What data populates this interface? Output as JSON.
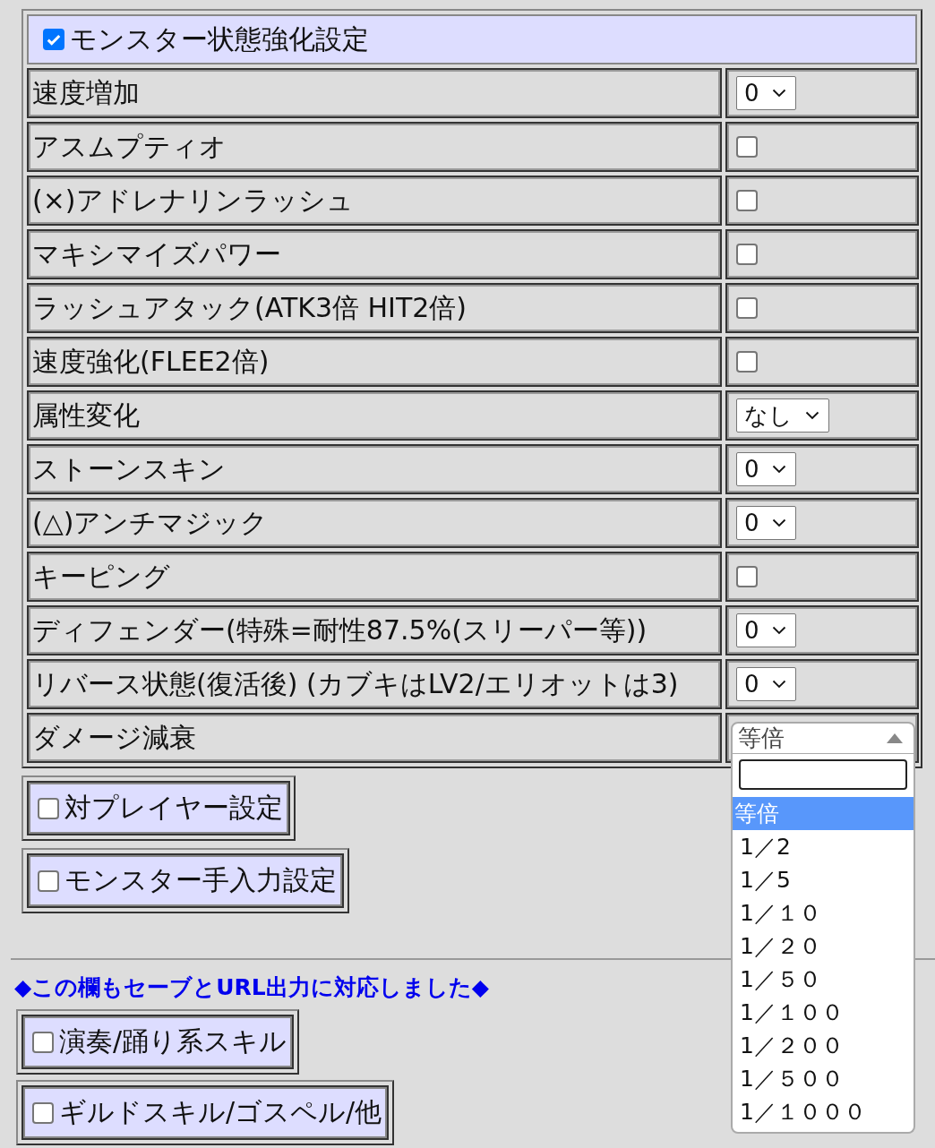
{
  "header": {
    "label": "モンスター状態強化設定",
    "checked": true
  },
  "rows": [
    {
      "label": "速度増加",
      "kind": "select",
      "value": "0"
    },
    {
      "label": "アスムプティオ",
      "kind": "checkbox",
      "checked": false
    },
    {
      "label": "(×)アドレナリンラッシュ",
      "kind": "checkbox",
      "checked": false
    },
    {
      "label": "マキシマイズパワー",
      "kind": "checkbox",
      "checked": false
    },
    {
      "label": "ラッシュアタック(ATK3倍 HIT2倍)",
      "kind": "checkbox",
      "checked": false
    },
    {
      "label": "速度強化(FLEE2倍)",
      "kind": "checkbox",
      "checked": false
    },
    {
      "label": "属性変化",
      "kind": "select",
      "value": "なし"
    },
    {
      "label": "ストーンスキン",
      "kind": "select",
      "value": "0"
    },
    {
      "label": "(△)アンチマジック",
      "kind": "select",
      "value": "0"
    },
    {
      "label": "キーピング",
      "kind": "checkbox",
      "checked": false
    },
    {
      "label": "ディフェンダー(特殊=耐性87.5%(スリーパー等))",
      "kind": "select",
      "value": "0"
    },
    {
      "label": "リバース状態(復活後) (カブキはLV2/エリオットは3)",
      "kind": "select",
      "value": "0"
    },
    {
      "label": "ダメージ減衰",
      "kind": "open_select",
      "value": "等倍",
      "options": [
        {
          "label": "等倍",
          "selected": true
        },
        {
          "label": "1／2",
          "selected": false
        },
        {
          "label": "1／5",
          "selected": false
        },
        {
          "label": "1／１０",
          "selected": false
        },
        {
          "label": "1／２０",
          "selected": false
        },
        {
          "label": "1／５０",
          "selected": false
        },
        {
          "label": "1／１００",
          "selected": false
        },
        {
          "label": "1／２００",
          "selected": false
        },
        {
          "label": "1／５００",
          "selected": false
        },
        {
          "label": "1／１０００",
          "selected": false
        }
      ]
    }
  ],
  "sections": [
    {
      "label": "対プレイヤー設定",
      "checked": false
    },
    {
      "label": "モンスター手入力設定",
      "checked": false
    }
  ],
  "notice": "◆この欄もセーブとURL出力に対応しました◆",
  "more_sections": [
    {
      "label": "演奏/踊り系スキル",
      "checked": false
    },
    {
      "label": "ギルドスキル/ゴスペル/他",
      "checked": false
    }
  ]
}
